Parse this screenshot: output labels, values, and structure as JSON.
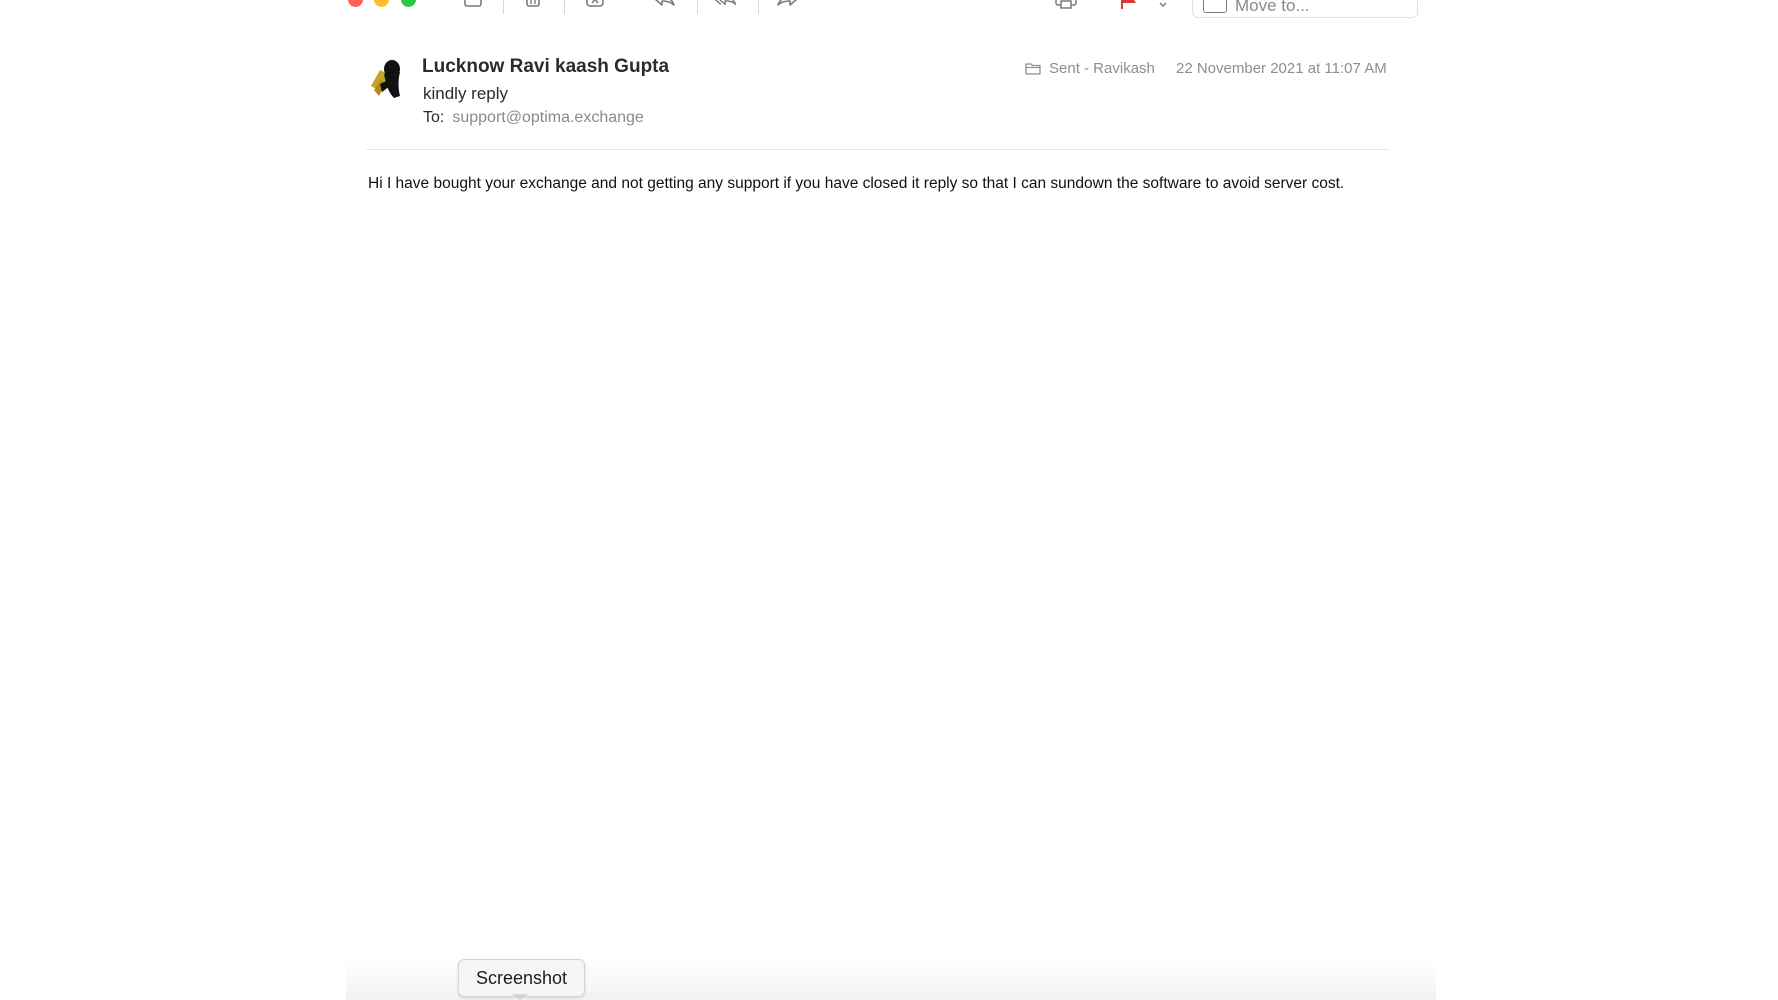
{
  "window": {
    "controls": [
      {
        "name": "close",
        "color": "#ff5f57"
      },
      {
        "name": "minimize",
        "color": "#febc2e"
      },
      {
        "name": "zoom",
        "color": "#28c840"
      }
    ]
  },
  "toolbar": {
    "icons": [
      "archive-icon",
      "trash-icon",
      "junk-icon",
      "reply-icon",
      "reply-all-icon",
      "forward-icon",
      "print-icon",
      "flag-icon",
      "flag-menu-chevron-icon"
    ],
    "move_placeholder": "Move to...",
    "flag_color": "#e0362c"
  },
  "message": {
    "sender": "Lucknow Ravi kaash Gupta",
    "subject": "kindly reply",
    "to_label": "To:",
    "to_address": "support@optima.exchange",
    "mailbox": "Sent - Ravikash",
    "date": "22 November 2021 at 11:07 AM",
    "body": "Hi I have bought your exchange and not getting any support if you have closed it reply so that I can sundown the software to avoid server cost."
  },
  "tooltip": {
    "label": "Screenshot"
  }
}
